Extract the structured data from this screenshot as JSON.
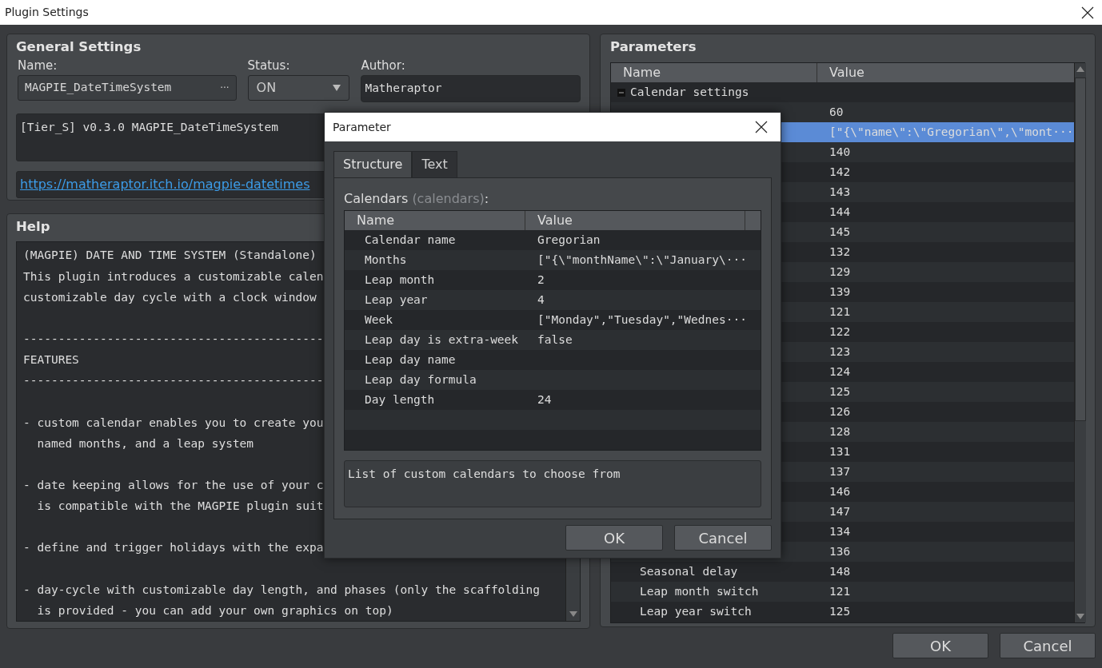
{
  "window": {
    "title": "Plugin Settings"
  },
  "general_settings": {
    "title": "General Settings",
    "name_label": "Name:",
    "name_value": "MAGPIE_DateTimeSystem",
    "browse_button": "···",
    "status_label": "Status:",
    "status_value": "ON",
    "author_label": "Author:",
    "author_value": "Matheraptor",
    "description": "[Tier_S] v0.3.0 MAGPIE_DateTimeSystem",
    "link": "https://matheraptor.itch.io/magpie-datetimes"
  },
  "help": {
    "title": "Help",
    "blocks": [
      [
        "(MAGPIE) DATE AND TIME SYSTEM (Standalone)",
        "This plugin introduces a customizable calen",
        "customizable day cycle with a clock window"
      ],
      [
        "-------------------------------------------",
        "FEATURES",
        "-------------------------------------------"
      ],
      [
        "- custom calendar enables you to create you",
        "  named months, and a leap system"
      ],
      [
        "- date keeping allows for the use of your c",
        "  is compatible with the MAGPIE plugin suit"
      ],
      [
        "- define and trigger holidays with the expa"
      ],
      [
        "- day-cycle with customizable day length, and phases (only the scaffolding",
        "  is provided - you can add your own graphics on top)"
      ]
    ]
  },
  "parameters": {
    "title": "Parameters",
    "columns": [
      "Name",
      "Value"
    ],
    "rows": [
      {
        "name": "Calendar settings",
        "expanded": true,
        "children": [
          {
            "value": "60",
            "selected": false
          },
          {
            "value": "[\"{\\\"name\\\":\\\"Gregorian\\\",\\\"mont···",
            "selected": true
          },
          {
            "value": "140",
            "selected": false
          },
          {
            "value": "142",
            "selected": false
          },
          {
            "value": "143",
            "selected": false
          },
          {
            "value": "144",
            "selected": false
          },
          {
            "value": "145",
            "selected": false
          },
          {
            "value": "132",
            "selected": false
          },
          {
            "value": "129",
            "selected": false
          },
          {
            "value": "139",
            "selected": false
          },
          {
            "value": "121",
            "selected": false
          },
          {
            "value": "122",
            "selected": false
          },
          {
            "value": "123",
            "selected": false
          },
          {
            "value": "124",
            "selected": false
          },
          {
            "value": "125",
            "selected": false
          },
          {
            "value": "126",
            "selected": false
          },
          {
            "value": "128",
            "selected": false
          },
          {
            "value": "131",
            "selected": false
          },
          {
            "value": "137",
            "selected": false
          },
          {
            "value": "146",
            "selected": false
          },
          {
            "value": "147",
            "selected": false
          },
          {
            "value": "134",
            "selected": false
          },
          {
            "value": "136",
            "selected": false
          },
          {
            "name": "Seasonal delay",
            "value": "148",
            "selected": false
          },
          {
            "name": "Leap month switch",
            "value": "121",
            "selected": false
          },
          {
            "name": "Leap year switch",
            "value": "125",
            "selected": false
          }
        ]
      }
    ]
  },
  "buttons": [
    "OK",
    "Cancel"
  ],
  "dialog": {
    "title": "Parameter",
    "tabs": [
      {
        "label": "Structure",
        "selected": true
      },
      {
        "label": "Text",
        "selected": false
      }
    ],
    "field_label": "Calendars",
    "field_key": "(calendars)",
    "field_suffix": ":",
    "columns": [
      "Name",
      "Value"
    ],
    "rows": [
      {
        "name": "Calendar name",
        "value": "Gregorian"
      },
      {
        "name": "Months",
        "value": "[\"{\\\"monthName\\\":\\\"January\\···"
      },
      {
        "name": "Leap month",
        "value": "2"
      },
      {
        "name": "Leap year",
        "value": "4"
      },
      {
        "name": "Week",
        "value": "[\"Monday\",\"Tuesday\",\"Wednes···"
      },
      {
        "name": "Leap day is extra-week",
        "value": "false"
      },
      {
        "name": "Leap day name"
      },
      {
        "name": "Leap day formula"
      },
      {
        "name": "Day length",
        "value": "24"
      }
    ],
    "description": "List of custom calendars to choose from",
    "buttons": [
      "OK",
      "Cancel"
    ]
  }
}
